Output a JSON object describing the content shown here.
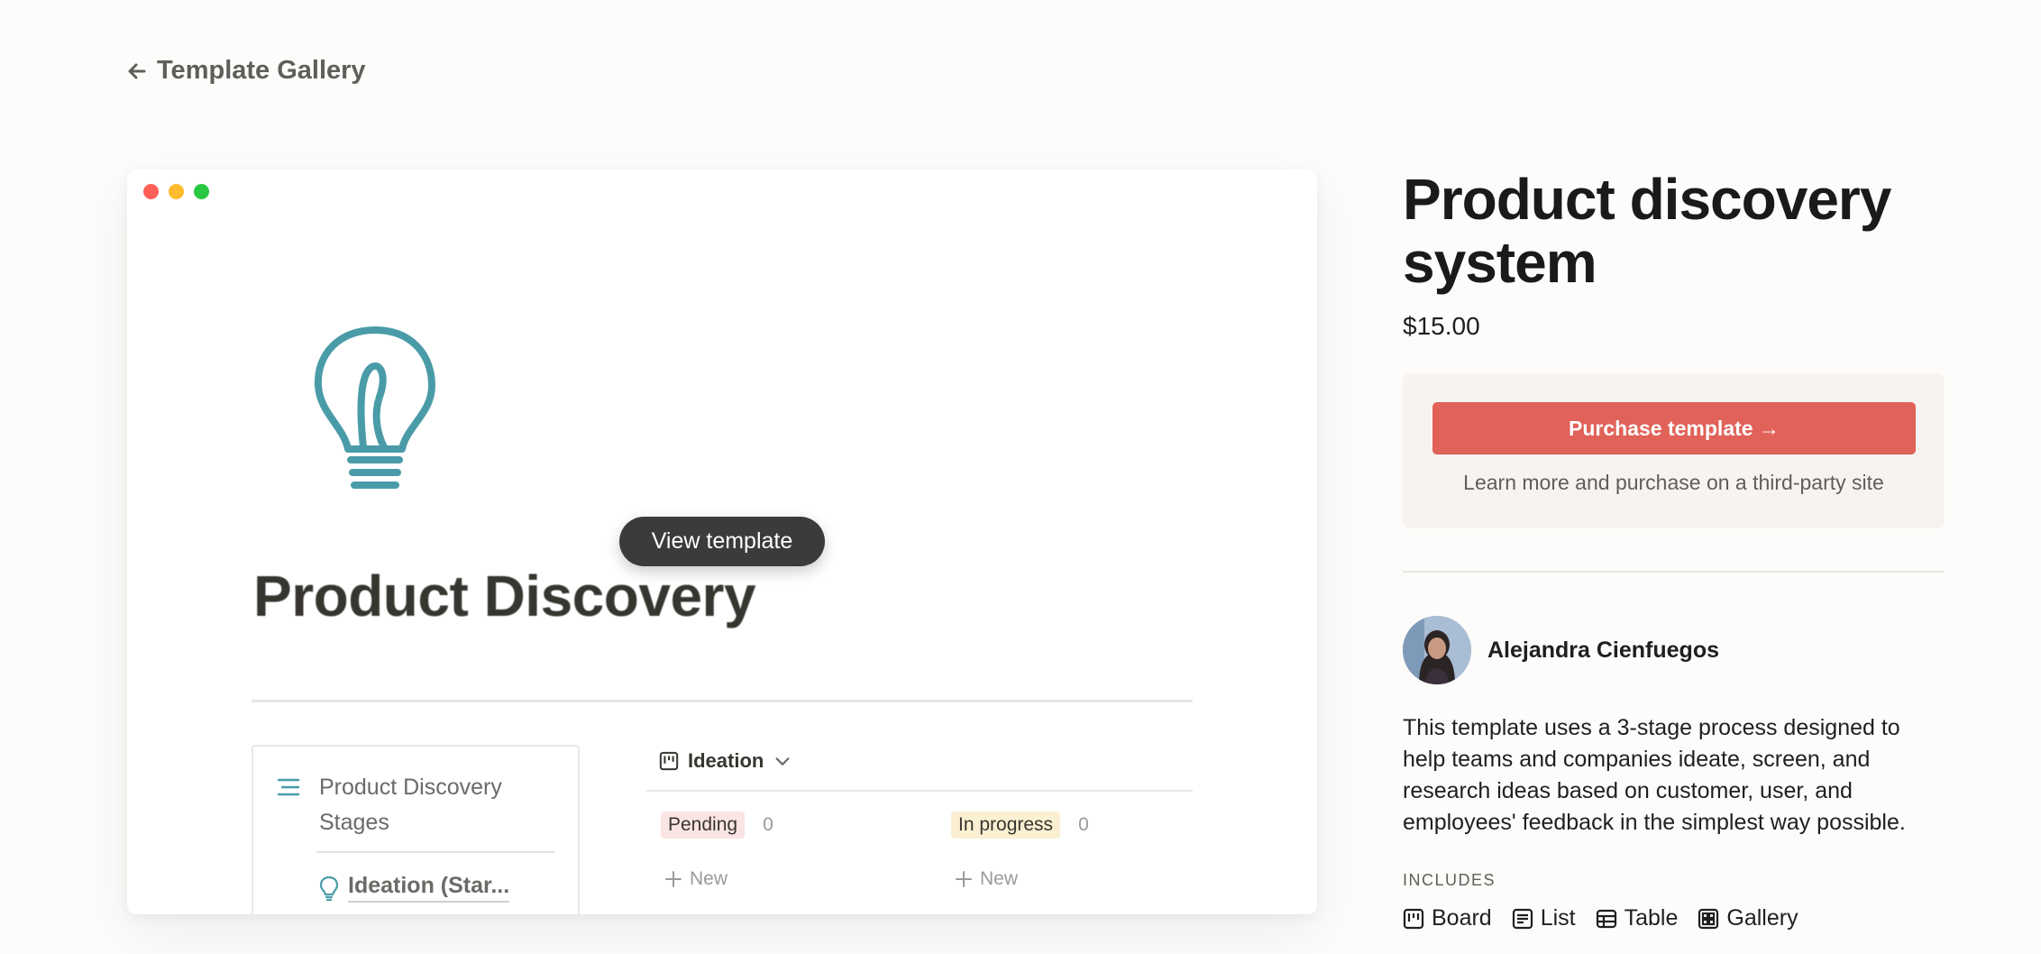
{
  "nav": {
    "back_label": "Template Gallery"
  },
  "preview": {
    "view_button": "View template",
    "page_title": "Product Discovery",
    "sidebar": {
      "heading": "Product Discovery Stages",
      "item": "Ideation (Star..."
    },
    "board": {
      "view_name": "Ideation",
      "columns": [
        {
          "label": "Pending",
          "count": "0",
          "color": "#fbe4e4",
          "new_label": "New"
        },
        {
          "label": "In progress",
          "count": "0",
          "color": "#fbefd2",
          "new_label": "New"
        }
      ]
    },
    "traffic_colors": [
      "#ff5f57",
      "#febc2e",
      "#28c840"
    ],
    "icon_color": "#4a9ba8"
  },
  "product": {
    "title": "Product discovery system",
    "price": "$15.00",
    "purchase_button": "Purchase template →",
    "purchase_note": "Learn more and purchase on a third-party site",
    "author": "Alejandra Cienfuegos",
    "description": "This template uses a 3-stage process designed to help teams and companies ideate, screen, and research ideas based on customer, user, and employees' feedback in the simplest way possible.",
    "includes_label": "INCLUDES",
    "includes": [
      "Board",
      "List",
      "Table",
      "Gallery"
    ],
    "accent": "#e16259"
  }
}
